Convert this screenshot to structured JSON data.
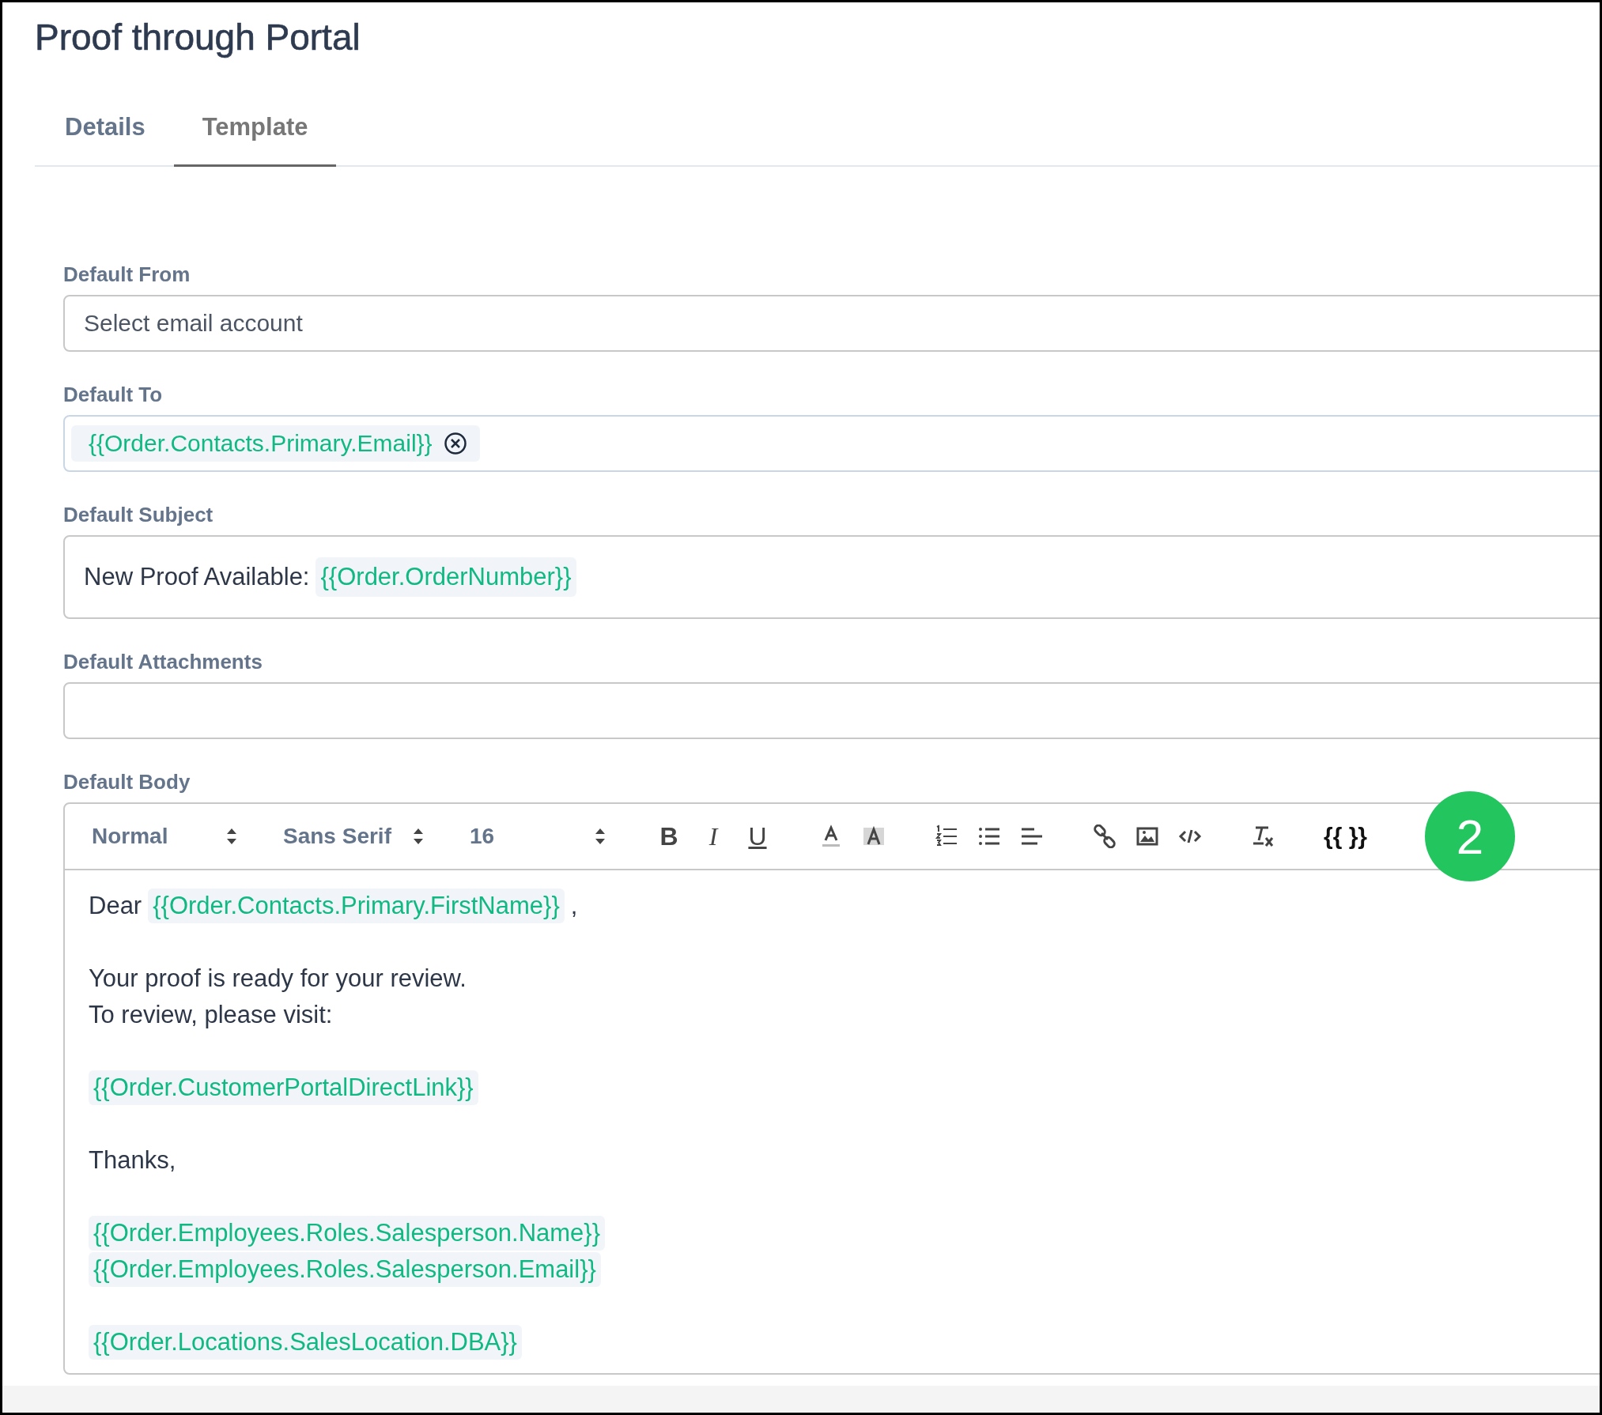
{
  "title": "Proof through Portal",
  "tabs": [
    {
      "label": "Details",
      "selected": false
    },
    {
      "label": "Template",
      "selected": true
    }
  ],
  "fields": [
    {
      "kind": "select",
      "label": "Default From",
      "placeholder": "Select email account"
    },
    {
      "kind": "tags",
      "label": "Default To",
      "tags": [
        {
          "text": "{{Order.Contacts.Primary.Email}}",
          "removable": true
        }
      ]
    },
    {
      "kind": "rich",
      "label": "Default Subject",
      "parts": [
        {
          "kind": "text",
          "text": "New Proof Available:"
        },
        {
          "kind": "tag",
          "text": "{{Order.OrderNumber}}"
        }
      ]
    },
    {
      "kind": "empty",
      "label": "Default Attachments"
    }
  ],
  "body": {
    "label": "Default Body",
    "selects": [
      {
        "kind": "heading",
        "value": "Normal"
      },
      {
        "kind": "font",
        "value": "Sans Serif"
      },
      {
        "kind": "size",
        "value": "16"
      }
    ],
    "buttons": [
      [
        {
          "kind": "bold",
          "glyph": "B"
        },
        {
          "kind": "italic",
          "glyph": "I"
        },
        {
          "kind": "underline",
          "glyph": "U"
        }
      ],
      [
        {
          "kind": "color"
        },
        {
          "kind": "background"
        }
      ],
      [
        {
          "kind": "ordered-list"
        },
        {
          "kind": "bullet-list"
        },
        {
          "kind": "align"
        }
      ],
      [
        {
          "kind": "link"
        },
        {
          "kind": "image"
        },
        {
          "kind": "code"
        }
      ],
      [
        {
          "kind": "clear-format"
        }
      ],
      [
        {
          "kind": "insert",
          "glyph": "{{ }}"
        }
      ]
    ],
    "badge": "2",
    "paragraphs": [
      [
        [
          {
            "kind": "text",
            "text": "Dear"
          },
          {
            "kind": "tag",
            "text": "{{Order.Contacts.Primary.FirstName}}"
          },
          {
            "kind": "text",
            "text": ","
          }
        ]
      ],
      [
        [
          {
            "kind": "text",
            "text": "Your proof is ready for your review."
          }
        ],
        [
          {
            "kind": "text",
            "text": "To review, please visit:"
          }
        ]
      ],
      [
        [
          {
            "kind": "tag",
            "text": "{{Order.CustomerPortalDirectLink}}"
          }
        ]
      ],
      [
        [
          {
            "kind": "text",
            "text": "Thanks,"
          }
        ]
      ],
      [
        [
          {
            "kind": "tag",
            "text": "{{Order.Employees.Roles.Salesperson.Name}}"
          }
        ],
        [
          {
            "kind": "tag",
            "text": "{{Order.Employees.Roles.Salesperson.Email}}"
          }
        ]
      ],
      [
        [
          {
            "kind": "tag",
            "text": "{{Order.Locations.SalesLocation.DBA}}"
          }
        ]
      ]
    ]
  }
}
